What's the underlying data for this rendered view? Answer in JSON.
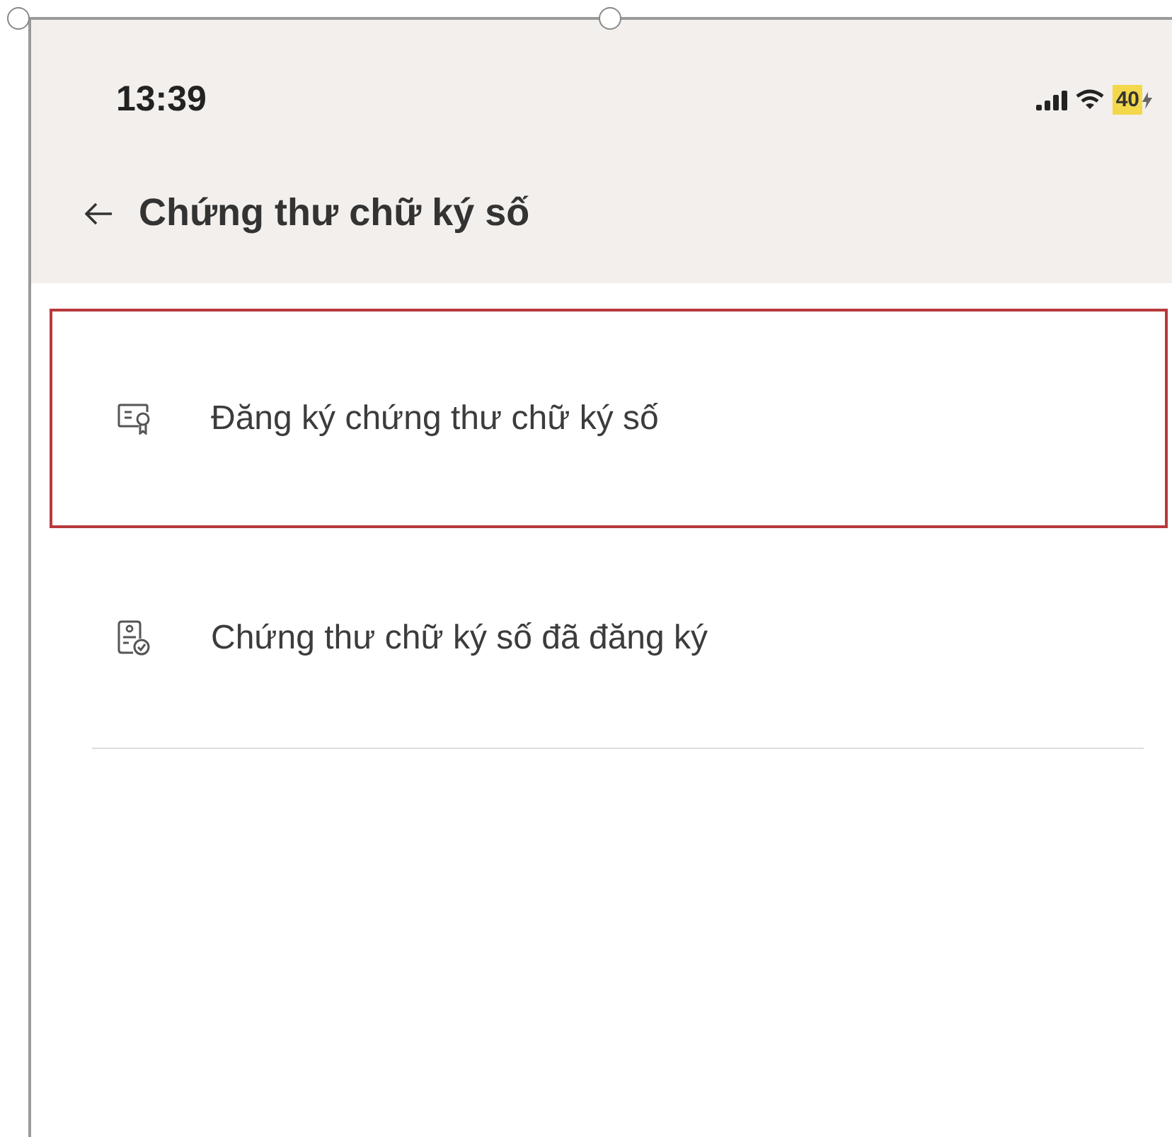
{
  "status_bar": {
    "time": "13:39",
    "battery": "40"
  },
  "header": {
    "title": "Chứng thư chữ ký số"
  },
  "menu": [
    {
      "kind": "certificate",
      "label": "Đăng ký chứng thư chữ ký số",
      "selected": true
    },
    {
      "kind": "registered",
      "label": "Chứng thư chữ ký số đã đăng ký",
      "selected": false
    }
  ]
}
